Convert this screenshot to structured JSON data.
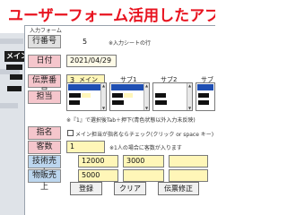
{
  "banner": {
    "title": "ユーザーフォーム活用したアプリ事"
  },
  "background": {
    "menu_button": "メイン"
  },
  "form": {
    "title": "入力フォーム",
    "row_number": {
      "label": "行番号",
      "value": "5",
      "note": "※入力シートの行"
    },
    "date": {
      "label": "日付",
      "value": "2021/04/29"
    },
    "slip_number": {
      "label": "伝票番号",
      "value": "3"
    },
    "staff": {
      "label": "担当",
      "main_label": "メイン",
      "sub1_label": "サブ1",
      "sub2_label": "サブ2",
      "sub3_label": "サブ",
      "note": "※『1』で選択後Tab＋押下(青色状態以外入力未反映)"
    },
    "nomination": {
      "label": "指名",
      "checkbox_label": "メイン担当が指名ならチェック(クリック or space キー)"
    },
    "customers": {
      "label": "客数",
      "value": "1",
      "note": "※1人の場合に客数が入ります"
    },
    "technical_sales": {
      "label": "技術売上",
      "values": [
        "12000",
        "3000",
        ""
      ]
    },
    "product_sales": {
      "label": "物販売上",
      "values": [
        "5000",
        "",
        ""
      ]
    },
    "buttons": {
      "register": "登録",
      "clear": "クリア",
      "slip_edit": "伝票修正"
    }
  },
  "colors": {
    "banner_text": "#e8131f",
    "label_pink": "#f5c6cc",
    "selection_blue": "#1f4fb3",
    "input_yellow": "#fff6b8"
  }
}
